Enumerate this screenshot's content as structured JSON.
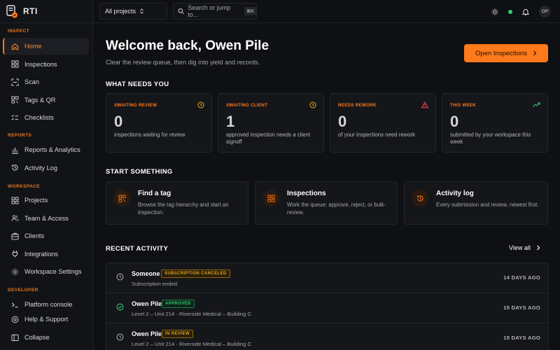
{
  "brand": {
    "name": "RTI"
  },
  "sidebar": {
    "inspect_label": "INSPECT",
    "inspect_items": [
      {
        "label": "Home",
        "icon": "home-icon",
        "active": true
      },
      {
        "label": "Inspections",
        "icon": "grid-icon"
      },
      {
        "label": "Scan",
        "icon": "scan-icon"
      },
      {
        "label": "Tags & QR",
        "icon": "qr-icon"
      },
      {
        "label": "Checklists",
        "icon": "checklist-icon"
      }
    ],
    "reports_label": "REPORTS",
    "reports_items": [
      {
        "label": "Reports & Analytics",
        "icon": "bar-chart-icon"
      },
      {
        "label": "Activity Log",
        "icon": "history-icon"
      }
    ],
    "workspace_label": "WORKSPACE",
    "workspace_items": [
      {
        "label": "Projects",
        "icon": "folder-icon"
      },
      {
        "label": "Team & Access",
        "icon": "users-icon"
      },
      {
        "label": "Clients",
        "icon": "clients-icon"
      },
      {
        "label": "Integrations",
        "icon": "plug-icon"
      },
      {
        "label": "Workspace Settings",
        "icon": "gear-icon"
      }
    ],
    "developer_label": "DEVELOPER",
    "developer_items": [
      {
        "label": "Platform console",
        "icon": "terminal-icon"
      }
    ],
    "help_label": "Help & Support",
    "collapse_label": "Collapse"
  },
  "topbar": {
    "project_select": "All projects",
    "search_placeholder": "Search or jump to...",
    "search_shortcut": "⌘K",
    "avatar_initials": "OP",
    "status_color": "#2ecc71"
  },
  "main": {
    "welcome": "Welcome back, Owen Pile",
    "subtitle": "Clear the review queue, then dig into yield and records.",
    "open_button": "Open Inspections",
    "needs_heading": "WHAT NEEDS YOU",
    "cards": [
      {
        "label": "AWAITING REVIEW",
        "value": "0",
        "desc": "inspections waiting for review",
        "icon": "clock-icon"
      },
      {
        "label": "AWAITING CLIENT",
        "value": "1",
        "desc": "approved inspection needs a client signoff",
        "icon": "clock-icon"
      },
      {
        "label": "NEEDS REWORK",
        "value": "0",
        "desc": "of your inspections need rework",
        "icon": "warning-icon"
      },
      {
        "label": "THIS WEEK",
        "value": "0",
        "desc": "submitted by your workspace this week",
        "icon": "trend-up-icon"
      }
    ],
    "start_heading": "START SOMETHING",
    "actions": [
      {
        "title": "Find a tag",
        "desc": "Browse the tag hierarchy and start an inspection.",
        "icon": "qr-icon"
      },
      {
        "title": "Inspections",
        "desc": "Work the queue: approve, reject, or bulk-review.",
        "icon": "grid-icon"
      },
      {
        "title": "Activity log",
        "desc": "Every submission and review, newest first.",
        "icon": "history-icon"
      }
    ],
    "recent_heading": "RECENT ACTIVITY",
    "view_all": "View all",
    "activity": [
      {
        "who": "Someone",
        "badge": "SUBSCRIPTION CANCELED",
        "badge_color": "#e0a21a",
        "sub": "Subscription ended",
        "when": "14 DAYS AGO",
        "icon": "clock-icon"
      },
      {
        "who": "Owen Pile",
        "badge": "APPROVED",
        "badge_color": "#2ecc71",
        "sub": "Level 2 – Unit 214 · Riverside Medical – Building C",
        "when": "15 DAYS AGO",
        "icon": "check-circle-icon"
      },
      {
        "who": "Owen Pile",
        "badge": "IN REVIEW",
        "badge_color": "#e0a21a",
        "sub": "Level 2 – Unit 214 · Riverside Medical – Building C",
        "when": "15 DAYS AGO",
        "icon": "clock-icon"
      }
    ]
  },
  "colors": {
    "accent": "#ff7a1a",
    "background": "#0f1013",
    "card": "#15161a"
  }
}
